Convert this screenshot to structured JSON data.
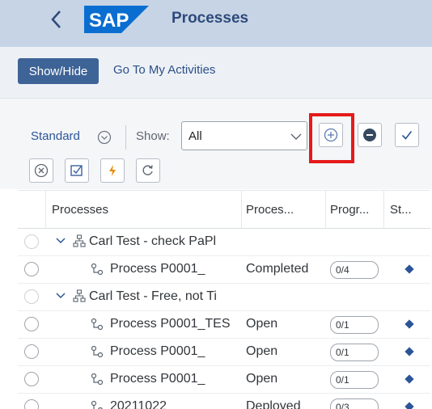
{
  "shell": {
    "title": "Processes",
    "logo_text": "SAP",
    "brand_color": "#0a6ed1"
  },
  "toolbar": {
    "show_hide_label": "Show/Hide",
    "goto_label": "Go To My Activities"
  },
  "filter": {
    "variant_label": "Standard",
    "show_label": "Show:",
    "show_value": "All"
  },
  "actions": [
    "add-icon",
    "remove-icon",
    "confirm-icon",
    "cancel-icon",
    "checklist-icon",
    "lightning-icon",
    "refresh-icon"
  ],
  "table": {
    "headers": {
      "processes": "Processes",
      "process_status": "Proces...",
      "progress": "Progr...",
      "status": "St..."
    },
    "rows": [
      {
        "type": "group",
        "name": "Carl Test - check PaPl",
        "status": "",
        "progress": ""
      },
      {
        "type": "process",
        "name": "Process P0001_",
        "status": "Completed",
        "progress": "0/4"
      },
      {
        "type": "group",
        "name": "Carl Test - Free, not Ti",
        "status": "",
        "progress": ""
      },
      {
        "type": "process",
        "name": "Process P0001_TES",
        "status": "Open",
        "progress": "0/1"
      },
      {
        "type": "process",
        "name": "Process P0001_",
        "status": "Open",
        "progress": "0/1"
      },
      {
        "type": "process",
        "name": "Process P0001_",
        "status": "Open",
        "progress": "0/1"
      },
      {
        "type": "process",
        "name": "20211022",
        "status": "Deployed",
        "progress": "0/3"
      }
    ]
  }
}
